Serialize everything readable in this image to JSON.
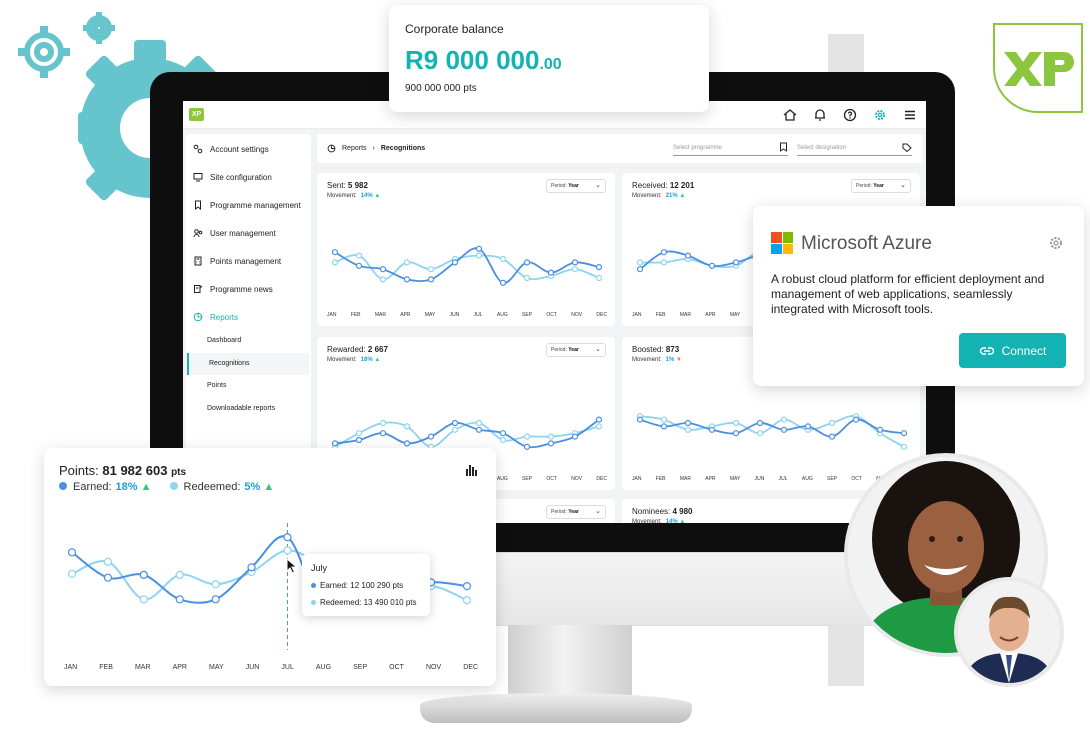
{
  "balance_card": {
    "label": "Corporate balance",
    "value": "R9 000 000",
    "value_cents": ".00",
    "points": "900 000 000 pts"
  },
  "app": {
    "brand": "XP",
    "topbar_icons": [
      "home-icon",
      "bell-icon",
      "help-icon",
      "settings-icon",
      "menu-icon"
    ],
    "sidebar": {
      "items": [
        {
          "label": "Account settings",
          "icon": "settings-sliders-icon"
        },
        {
          "label": "Site configuration",
          "icon": "monitor-icon"
        },
        {
          "label": "Programme management",
          "icon": "bookmark-icon"
        },
        {
          "label": "User management",
          "icon": "users-icon"
        },
        {
          "label": "Points management",
          "icon": "calculator-icon"
        },
        {
          "label": "Programme news",
          "icon": "news-icon"
        },
        {
          "label": "Reports",
          "icon": "chart-pie-icon"
        }
      ],
      "subitems": [
        "Dashboard",
        "Recognitions",
        "Points",
        "Downloadable reports"
      ]
    },
    "breadcrumb": {
      "parent": "Reports",
      "current": "Recognitions"
    },
    "filters": {
      "programme_placeholder": "Select programme",
      "designation_placeholder": "Select designation"
    },
    "cards": [
      {
        "title": "Sent:",
        "value": "5 982",
        "movement_label": "Movement:",
        "movement": "14%",
        "trend": "up",
        "period_label": "Period:",
        "period": "Year"
      },
      {
        "title": "Received:",
        "value": "12 201",
        "movement_label": "Movement:",
        "movement": "21%",
        "trend": "up",
        "period_label": "Period:",
        "period": "Year"
      },
      {
        "title": "Rewarded:",
        "value": "2 667",
        "movement_label": "Movement:",
        "movement": "18%",
        "trend": "up",
        "period_label": "Period:",
        "period": "Year"
      },
      {
        "title": "Boosted:",
        "value": "873",
        "movement_label": "Movement:",
        "movement": "1%",
        "trend": "down",
        "period_label": "Period:",
        "period": "Year"
      },
      {
        "title": "",
        "value": "",
        "period_label": "Period:",
        "period": "Year"
      },
      {
        "title": "Nominees:",
        "value": "4 980",
        "movement_label": "Movement:",
        "movement": "14%",
        "trend": "up"
      }
    ],
    "month_labels": [
      "JAN",
      "FEB",
      "MAR",
      "APR",
      "MAY",
      "JUN",
      "JUL",
      "AUG",
      "SEP",
      "OCT",
      "NOV",
      "DEC"
    ]
  },
  "azure_card": {
    "name": "Microsoft Azure",
    "description": "A robust cloud platform for efficient deployment and management of web applications, seamlessly integrated with Microsoft tools.",
    "button": "Connect",
    "logo_colors": [
      "#f25022",
      "#7fba00",
      "#00a4ef",
      "#ffb900"
    ]
  },
  "points_card": {
    "title": "Points:",
    "value": "81 982 603",
    "unit": "pts",
    "legend": [
      {
        "name": "Earned:",
        "pct": "18%",
        "color": "#4a8fe0"
      },
      {
        "name": "Redeemed:",
        "pct": "5%",
        "color": "#8fd3f2"
      }
    ],
    "tooltip": {
      "month": "July",
      "earned": "Earned: 12 100 290 pts",
      "redeemed": "Redeemed: 13 490 010 pts"
    }
  },
  "colors": {
    "accent": "#13b3b3",
    "earned": "#4a8fe0",
    "redeemed": "#8fd3f2",
    "up": "#3cc47c",
    "down": "#f0743c",
    "xp_green": "#8cc63f"
  },
  "chart_data": [
    {
      "type": "line",
      "title": "Points: 81 982 603 pts",
      "categories": [
        "JAN",
        "FEB",
        "MAR",
        "APR",
        "MAY",
        "JUN",
        "JUL",
        "AUG",
        "SEP",
        "OCT",
        "NOV",
        "DEC"
      ],
      "series": [
        {
          "name": "Earned:",
          "values": [
            72,
            45,
            48,
            22,
            22,
            56,
            88,
            12,
            45,
            30,
            40,
            36
          ]
        },
        {
          "name": "Redeemed:",
          "values": [
            49,
            62,
            22,
            48,
            38,
            51,
            74,
            55,
            20,
            24,
            36,
            21
          ]
        }
      ]
    },
    {
      "type": "line",
      "title": "Sent: 5 982",
      "categories": [
        "JAN",
        "FEB",
        "MAR",
        "APR",
        "MAY",
        "JUN",
        "JUL",
        "AUG",
        "SEP",
        "OCT",
        "NOV",
        "DEC"
      ],
      "series": [
        {
          "values": [
            60,
            40,
            35,
            20,
            20,
            45,
            65,
            15,
            45,
            30,
            45,
            38
          ]
        },
        {
          "values": [
            45,
            55,
            20,
            45,
            35,
            50,
            55,
            50,
            22,
            25,
            35,
            22
          ]
        }
      ]
    },
    {
      "type": "line",
      "title": "Received: 12 201",
      "categories": [
        "JAN",
        "FEB",
        "MAR",
        "APR",
        "MAY",
        "JUN",
        "JUL",
        "AUG",
        "SEP",
        "OCT",
        "NOV",
        "DEC"
      ],
      "series": [
        {
          "values": [
            35,
            60,
            55,
            40,
            45,
            55,
            50,
            45,
            40,
            50,
            45,
            40
          ]
        },
        {
          "values": [
            45,
            45,
            50,
            40,
            40,
            60,
            40,
            55,
            35,
            45,
            40,
            30
          ]
        }
      ]
    },
    {
      "type": "line",
      "title": "Rewarded: 2 667",
      "categories": [
        "JAN",
        "FEB",
        "MAR",
        "APR",
        "MAY",
        "JUN",
        "JUL",
        "AUG",
        "SEP",
        "OCT",
        "NOV",
        "DEC"
      ],
      "series": [
        {
          "values": [
            20,
            25,
            35,
            20,
            30,
            50,
            40,
            35,
            15,
            20,
            30,
            55
          ]
        },
        {
          "values": [
            15,
            35,
            50,
            45,
            15,
            40,
            50,
            25,
            30,
            30,
            35,
            45
          ]
        }
      ]
    },
    {
      "type": "line",
      "title": "Boosted: 873",
      "categories": [
        "JAN",
        "FEB",
        "MAR",
        "APR",
        "MAY",
        "JUN",
        "JUL",
        "AUG",
        "SEP",
        "OCT",
        "NOV",
        "DEC"
      ],
      "series": [
        {
          "values": [
            55,
            45,
            50,
            40,
            35,
            50,
            40,
            45,
            30,
            55,
            40,
            35
          ]
        },
        {
          "values": [
            60,
            55,
            40,
            45,
            50,
            35,
            55,
            40,
            50,
            60,
            35,
            15
          ]
        }
      ]
    }
  ]
}
